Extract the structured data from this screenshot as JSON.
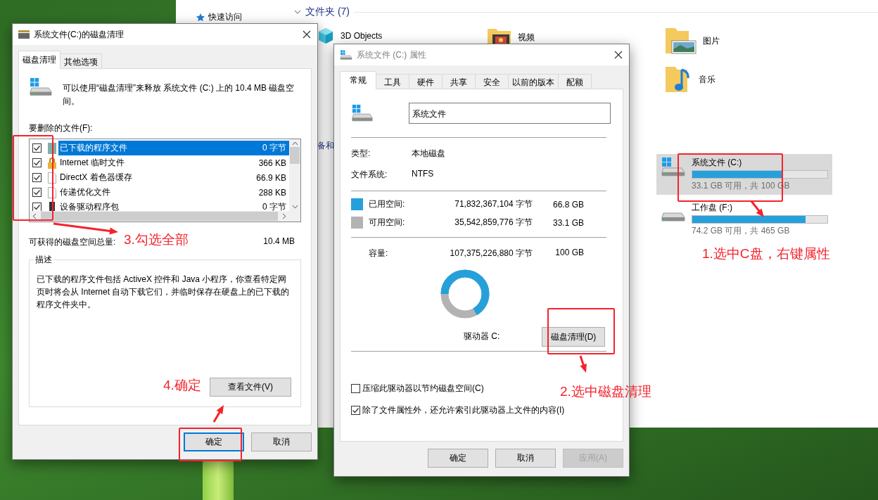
{
  "explorer": {
    "nav_item": "快速访问",
    "folders_heading": "文件夹 (7)",
    "folders": [
      {
        "name": "3D Objects",
        "kind": "cube"
      },
      {
        "name": "视频",
        "kind": "video"
      },
      {
        "name": "图片",
        "kind": "pictures"
      },
      {
        "name": "音乐",
        "kind": "music"
      }
    ],
    "devices_heading": "备和",
    "drives": [
      {
        "name": "系统文件 (C:)",
        "level": 0.669,
        "caption": "33.1 GB 可用，共 100 GB",
        "selected": true,
        "kind": "system"
      },
      {
        "name": "工作盘 (F:)",
        "level": 0.84,
        "caption": "74.2 GB 可用，共 465 GB",
        "selected": false,
        "kind": "data"
      }
    ]
  },
  "cleanup_dialog": {
    "title": "系统文件(C:)的磁盘清理",
    "tabs": [
      {
        "label": "磁盘清理",
        "selected": true
      },
      {
        "label": "其他选项",
        "selected": false
      }
    ],
    "intro": "可以使用“磁盘清理”来释放 系统文件 (C:) 上的 10.4 MB 磁盘空间。",
    "files_label": "要删除的文件(F):",
    "files": [
      {
        "name": "已下载的程序文件",
        "size": "0 字节",
        "checked": true,
        "selected": true,
        "kind": "folder"
      },
      {
        "name": "Internet 临时文件",
        "size": "366 KB",
        "checked": true,
        "selected": false,
        "kind": "lock"
      },
      {
        "name": "DirectX 着色器缓存",
        "size": "66.9 KB",
        "checked": true,
        "selected": false,
        "kind": "document"
      },
      {
        "name": "传递优化文件",
        "size": "288 KB",
        "checked": true,
        "selected": false,
        "kind": "document"
      },
      {
        "name": "设备驱动程序包",
        "size": "0 字节",
        "checked": true,
        "selected": false,
        "kind": "device"
      }
    ],
    "total_label": "可获得的磁盘空间总量:",
    "total_value": "10.4 MB",
    "description_label": "描述",
    "description": "已下载的程序文件包括 ActiveX 控件和 Java 小程序，你查看特定网页时将会从 Internet 自动下载它们，并临时保存在硬盘上的已下载的程序文件夹中。",
    "view_button": "查看文件(V)",
    "buttons": [
      {
        "label": "确定",
        "default": true
      },
      {
        "label": "取消",
        "default": false
      }
    ]
  },
  "properties_dialog": {
    "title": "系统文件 (C:) 属性",
    "tabs": [
      {
        "label": "常规",
        "selected": true
      },
      {
        "label": "工具",
        "selected": false
      },
      {
        "label": "硬件",
        "selected": false
      },
      {
        "label": "共享",
        "selected": false
      },
      {
        "label": "安全",
        "selected": false
      },
      {
        "label": "以前的版本",
        "selected": false
      },
      {
        "label": "配额",
        "selected": false
      }
    ],
    "name_value": "系统文件",
    "info": [
      {
        "label": "类型:",
        "value": "本地磁盘"
      },
      {
        "label": "文件系统:",
        "value": "NTFS"
      }
    ],
    "space": [
      {
        "label": "已用空间:",
        "bytes": "71,832,367,104 字节",
        "size": "66.8 GB",
        "kind": "used"
      },
      {
        "label": "可用空间:",
        "bytes": "35,542,859,776 字节",
        "size": "33.1 GB",
        "kind": "free"
      }
    ],
    "capacity": {
      "label": "容量:",
      "bytes": "107,375,226,880 字节",
      "size": "100 GB"
    },
    "usage": {
      "level": 0.668
    },
    "drive_label": "驱动器 C:",
    "cleanup_button": "磁盘清理(D)",
    "options": [
      {
        "label": "压缩此驱动器以节约磁盘空间(C)",
        "checked": false
      },
      {
        "label": "除了文件属性外，还允许索引此驱动器上文件的内容(I)",
        "checked": true
      }
    ],
    "buttons": [
      {
        "label": "确定",
        "disabled": false
      },
      {
        "label": "取消",
        "disabled": false
      },
      {
        "label": "应用(A)",
        "disabled": true
      }
    ]
  },
  "annotations": [
    {
      "text": "1.选中C盘，右键属性"
    },
    {
      "text": "2.选中磁盘清理"
    },
    {
      "text": "3.勾选全部"
    },
    {
      "text": "4.确定"
    }
  ]
}
